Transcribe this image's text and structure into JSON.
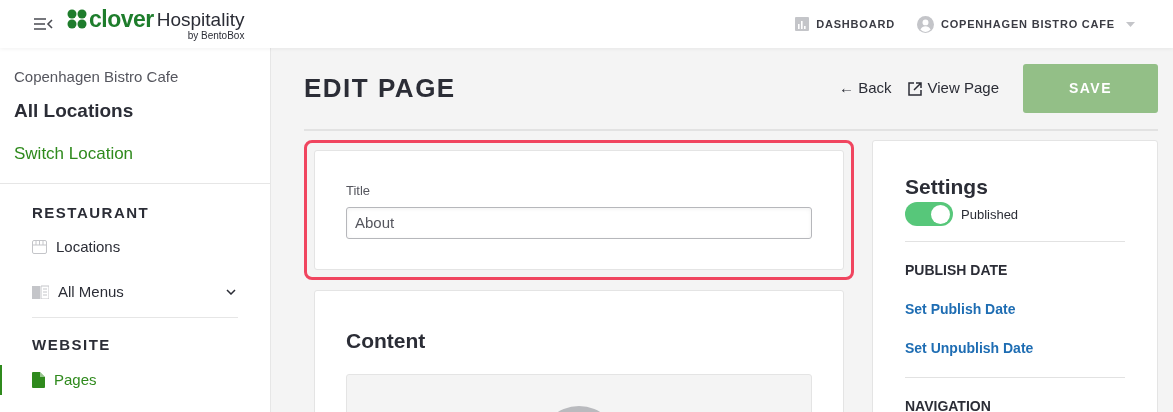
{
  "header": {
    "logo": {
      "word": "clover",
      "name": "Hospitality",
      "tagline": "by BentoBox"
    },
    "nav": [
      {
        "kind": "dashboard",
        "label": "DASHBOARD"
      },
      {
        "kind": "account",
        "label": "COPENHAGEN BISTRO CAFE"
      }
    ]
  },
  "sidebar": {
    "restaurant_name": "Copenhagen Bistro Cafe",
    "scope": "All Locations",
    "switch_link": "Switch Location",
    "sections": [
      {
        "heading": "RESTAURANT",
        "items": [
          {
            "label": "Locations",
            "kind": "store",
            "selected": false,
            "expandable": false
          },
          {
            "label": "All Menus",
            "kind": "menu",
            "selected": false,
            "expandable": true
          }
        ]
      },
      {
        "heading": "WEBSITE",
        "items": [
          {
            "label": "Pages",
            "kind": "page",
            "selected": true,
            "expandable": false
          }
        ]
      }
    ]
  },
  "page": {
    "title": "EDIT PAGE",
    "back": "← Back",
    "view_page": "View Page",
    "save": "SAVE",
    "save_disabled": true
  },
  "title_card": {
    "highlighted": true,
    "label": "Title",
    "value": "About"
  },
  "content_card": {
    "heading": "Content"
  },
  "settings": {
    "heading": "Settings",
    "published": {
      "on": true,
      "label": "Published"
    },
    "publish_date_heading": "PUBLISH DATE",
    "links": [
      "Set Publish Date",
      "Set Unpublish Date"
    ],
    "navigation_heading": "NAVIGATION"
  }
}
